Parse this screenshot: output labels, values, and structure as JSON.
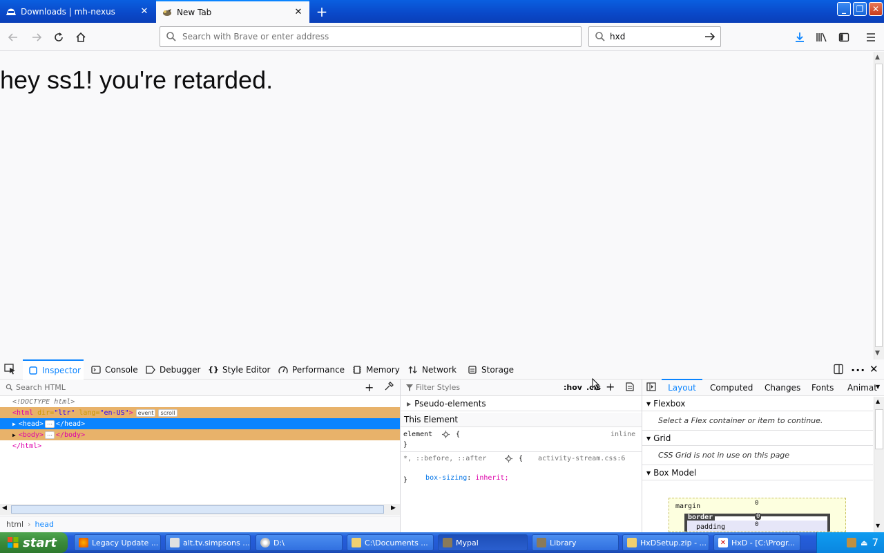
{
  "tabs": [
    {
      "title": "Downloads | mh-nexus",
      "active": false
    },
    {
      "title": "New Tab",
      "active": true
    }
  ],
  "toolbar": {
    "url_placeholder": "Search with Brave or enter address",
    "search_query": "hxd"
  },
  "page": {
    "heading": "hey ss1! you're retarded."
  },
  "devtools": {
    "tabs": [
      "Inspector",
      "Console",
      "Debugger",
      "Style Editor",
      "Performance",
      "Memory",
      "Network",
      "Storage"
    ],
    "search_html_placeholder": "Search HTML",
    "markup": {
      "doctype": "<!DOCTYPE html>",
      "html_open_tag": "<html",
      "html_attr1_name": "dir=",
      "html_attr1_value": "\"ltr\"",
      "html_attr2_name": "lang=",
      "html_attr2_value": "\"en-US\"",
      "html_badges": [
        "event",
        "scroll"
      ],
      "head_open": "<head>",
      "head_close": "</head>",
      "body_open": "<body>",
      "body_close": "</body>",
      "html_close": "</html>",
      "ellipsis": "⋯"
    },
    "breadcrumbs": [
      "html",
      "head"
    ],
    "rules": {
      "filter_placeholder": "Filter Styles",
      "hov": ":hov",
      "cls": ".cls",
      "pseudo_elements": "Pseudo-elements",
      "this_element": "This Element",
      "element_selector": "element",
      "element_source": "inline",
      "open_brace": "{",
      "close_brace": "}",
      "rule2_selector": "*, ::before, ::after",
      "rule2_source": "activity-stream.css:6",
      "rule2_prop": "box-sizing",
      "rule2_value": "inherit;"
    },
    "sidebar": {
      "tabs": [
        "Layout",
        "Computed",
        "Changes",
        "Fonts",
        "Animat"
      ],
      "flexbox_title": "Flexbox",
      "flexbox_note": "Select a Flex container or item to continue.",
      "grid_title": "Grid",
      "grid_note": "CSS Grid is not in use on this page",
      "boxmodel_title": "Box Model",
      "bm_margin": "margin",
      "bm_border": "border",
      "bm_padding": "padding",
      "bm_margin_val": "0",
      "bm_border_val": "0",
      "bm_padding_val": "0"
    }
  },
  "taskbar": {
    "start": "start",
    "items": [
      {
        "label": "Legacy Update ...",
        "icon": "firefox-icon",
        "active": false
      },
      {
        "label": "alt.tv.simpsons ...",
        "icon": "newsgroup-icon",
        "active": false
      },
      {
        "label": "D:\\",
        "icon": "cd-icon",
        "active": false
      },
      {
        "label": "C:\\Documents ...",
        "icon": "folder-icon",
        "active": false
      },
      {
        "label": "Mypal",
        "icon": "mypal-icon",
        "active": true
      },
      {
        "label": "Library",
        "icon": "mypal-icon",
        "active": false
      },
      {
        "label": "HxDSetup.zip - ...",
        "icon": "zip-folder-icon",
        "active": false
      },
      {
        "label": "HxD - [C:\\Progr...",
        "icon": "hxd-icon",
        "active": false
      }
    ],
    "clock": "7"
  },
  "colors": {
    "accent": "#0a84ff",
    "highlight_node": "#e8b26a",
    "taskbar": "#245edb",
    "start": "#3a8a3a"
  }
}
